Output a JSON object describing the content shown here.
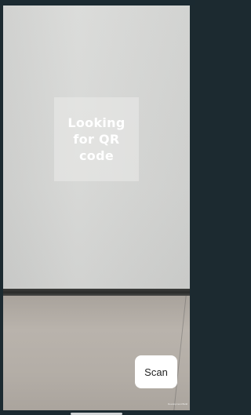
{
  "overlay": {
    "message": "Looking for QR code"
  },
  "actions": {
    "scan_label": "Scan"
  },
  "footer": {
    "dev_label": "Development Build"
  }
}
